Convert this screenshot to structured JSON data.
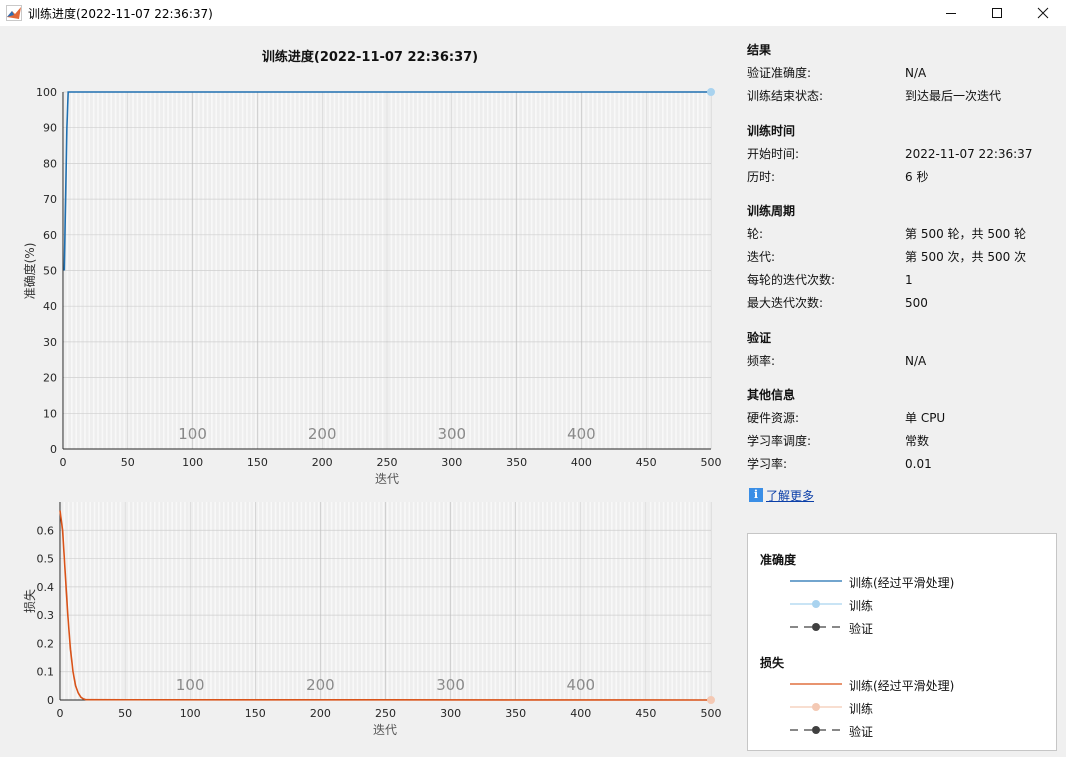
{
  "window": {
    "title": "训练进度(2022-11-07 22:36:37)",
    "controls": [
      "minimize-icon",
      "maximize-icon",
      "close-icon"
    ]
  },
  "plot_title": "训练进度(2022-11-07 22:36:37)",
  "colors": {
    "accuracy_smoothed": "#1f6fb0",
    "accuracy_train": "#a9d3ef",
    "loss_smoothed": "#d95319",
    "loss_train": "#f4c9b4",
    "validation": "#404040",
    "epoch_lines": "#dcdcdc"
  },
  "info": {
    "results": {
      "heading": "结果",
      "rows": [
        {
          "label": "验证准确度:",
          "value": "N/A"
        },
        {
          "label": "训练结束状态:",
          "value": "到达最后一次迭代"
        }
      ]
    },
    "time": {
      "heading": "训练时间",
      "rows": [
        {
          "label": "开始时间:",
          "value": "2022-11-07 22:36:37"
        },
        {
          "label": "历时:",
          "value": "6 秒"
        }
      ]
    },
    "cycle": {
      "heading": "训练周期",
      "rows": [
        {
          "label": "轮:",
          "value": "第 500 轮，共 500 轮"
        },
        {
          "label": "迭代:",
          "value": "第 500 次，共 500 次"
        },
        {
          "label": "每轮的迭代次数:",
          "value": "1"
        },
        {
          "label": "最大迭代次数:",
          "value": "500"
        }
      ]
    },
    "validation": {
      "heading": "验证",
      "rows": [
        {
          "label": "频率:",
          "value": "N/A"
        }
      ]
    },
    "other": {
      "heading": "其他信息",
      "rows": [
        {
          "label": "硬件资源:",
          "value": "单 CPU"
        },
        {
          "label": "学习率调度:",
          "value": "常数"
        },
        {
          "label": "学习率:",
          "value": "0.01"
        }
      ]
    },
    "learn_more": "了解更多",
    "learn_more_icon": "info-icon"
  },
  "legend": {
    "accuracy_heading": "准确度",
    "accuracy_items": [
      "训练(经过平滑处理)",
      "训练",
      "验证"
    ],
    "loss_heading": "损失",
    "loss_items": [
      "训练(经过平滑处理)",
      "训练",
      "验证"
    ]
  },
  "chart_data": [
    {
      "type": "line",
      "ylabel": "准确度(%)",
      "xlabel": "迭代",
      "xlim": [
        0,
        500
      ],
      "ylim": [
        0,
        100
      ],
      "xticks": [
        0,
        50,
        100,
        150,
        200,
        250,
        300,
        350,
        400,
        450,
        500
      ],
      "yticks": [
        0,
        10,
        20,
        30,
        40,
        50,
        60,
        70,
        80,
        90,
        100
      ],
      "epoch_labels": [
        100,
        200,
        300,
        400
      ],
      "grid": true,
      "series": [
        {
          "name": "训练(经过平滑处理)",
          "x": [
            1,
            2,
            3,
            4,
            5,
            500
          ],
          "y": [
            50,
            70,
            90,
            100,
            100,
            100
          ]
        },
        {
          "name": "训练",
          "x": [
            500
          ],
          "y": [
            100
          ]
        }
      ]
    },
    {
      "type": "line",
      "ylabel": "损失",
      "xlabel": "迭代",
      "xlim": [
        0,
        500
      ],
      "ylim": [
        0,
        0.7
      ],
      "xticks": [
        0,
        50,
        100,
        150,
        200,
        250,
        300,
        350,
        400,
        450,
        500
      ],
      "yticks": [
        0,
        0.1,
        0.2,
        0.3,
        0.4,
        0.5,
        0.6
      ],
      "epoch_labels": [
        100,
        200,
        300,
        400
      ],
      "grid": true,
      "series": [
        {
          "name": "训练(经过平滑处理)",
          "x": [
            0,
            2,
            4,
            6,
            8,
            10,
            12,
            14,
            16,
            18,
            20,
            500
          ],
          "y": [
            0.67,
            0.6,
            0.45,
            0.3,
            0.18,
            0.1,
            0.05,
            0.025,
            0.01,
            0.004,
            0.001,
            0.0
          ]
        },
        {
          "name": "训练",
          "x": [
            500
          ],
          "y": [
            0.0
          ]
        }
      ]
    }
  ]
}
